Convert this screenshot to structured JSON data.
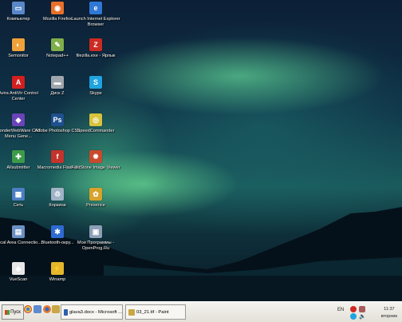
{
  "desktop_icons": [
    {
      "name": "Компьютер",
      "glyph": "▭",
      "color": "#5a87c9"
    },
    {
      "name": "Mozilla Firefox",
      "glyph": "◉",
      "color": "#e7702a"
    },
    {
      "name": "Launch Internet Explorer Browser",
      "glyph": "e",
      "color": "#2f78d6"
    },
    {
      "name": "Semonitor",
      "glyph": "◐",
      "color": "#f0a13a"
    },
    {
      "name": "Notepad++",
      "glyph": "✎",
      "color": "#7fae4b"
    },
    {
      "name": "filezilla.exe - Ярлык",
      "glyph": "Z",
      "color": "#cc2b22"
    },
    {
      "name": "Avira AntiVir Control Center",
      "glyph": "A",
      "color": "#d21f1f"
    },
    {
      "name": "Диск Z",
      "glyph": "▬",
      "color": "#9fa6ad"
    },
    {
      "name": "Skype",
      "glyph": "S",
      "color": "#1fa4e0"
    },
    {
      "name": "WonderWebWare CSS Menu Gene...",
      "glyph": "◆",
      "color": "#6a44b8"
    },
    {
      "name": "Adobe Photoshop CS3",
      "glyph": "Ps",
      "color": "#1e4f8f"
    },
    {
      "name": "SpeedCommander",
      "glyph": "◎",
      "color": "#d7c33c"
    },
    {
      "name": "Allsubmitter",
      "glyph": "✚",
      "color": "#3c9a4a"
    },
    {
      "name": "Macromedia Flash 8",
      "glyph": "f",
      "color": "#c4332b"
    },
    {
      "name": "FastStone Image Viewer",
      "glyph": "✹",
      "color": "#c84a2c"
    },
    {
      "name": "Сеть",
      "glyph": "▦",
      "color": "#4b7ec2"
    },
    {
      "name": "Корзина",
      "glyph": "♲",
      "color": "#9fb3c6"
    },
    {
      "name": "Presence",
      "glyph": "✿",
      "color": "#d7a32a"
    },
    {
      "name": "Local Area Connectio...",
      "glyph": "▤",
      "color": "#6a8fc4"
    },
    {
      "name": "Bluetooth-окру...",
      "glyph": "✱",
      "color": "#2e6ad1"
    },
    {
      "name": "Мои Программы - OpenProg.Ru",
      "glyph": "▣",
      "color": "#8d9fb7"
    },
    {
      "name": "VueScan",
      "glyph": "◈",
      "color": "#e7e7e7"
    },
    {
      "name": "Winamp",
      "glyph": "⚡",
      "color": "#e4b62c"
    }
  ],
  "taskbar": {
    "start_label": "Пуск",
    "buttons": [
      {
        "label": "glava3.docx - Microsoft ...",
        "color": "#2b5fb0"
      },
      {
        "label": "03_21.tif - Paint",
        "color": "#c9a646"
      }
    ],
    "language": "EN",
    "clock_time": "11:37",
    "clock_day": "вторник"
  }
}
